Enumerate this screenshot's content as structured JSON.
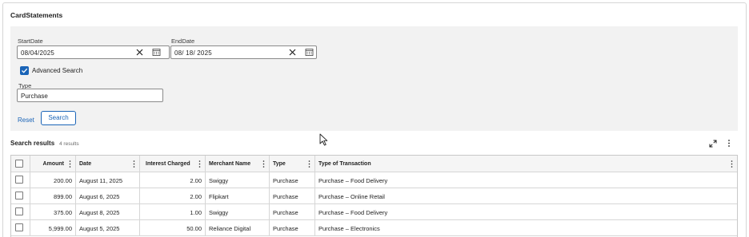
{
  "page": {
    "title": "CardStatements"
  },
  "filters": {
    "start_date_label": "StartDate",
    "start_date_value": "08/04/2025",
    "end_date_label": "EndDate",
    "end_date_value": "08/ 18/ 2025",
    "advanced_search_label": "Advanced Search",
    "advanced_search_checked": true,
    "type_label": "Type",
    "type_value": "Purchase",
    "reset_label": "Reset",
    "search_label": "Search"
  },
  "results": {
    "title": "Search results",
    "count_text": "4 results",
    "columns": [
      "Amount",
      "Date",
      "Interest Charged",
      "Merchant Name",
      "Type",
      "Type of Transaction"
    ],
    "rows": [
      {
        "amount": "200.00",
        "date": "August 11, 2025",
        "interest": "2.00",
        "merchant": "Swiggy",
        "type": "Purchase",
        "txn": "Purchase – Food Delivery"
      },
      {
        "amount": "899.00",
        "date": "August 6, 2025",
        "interest": "2.00",
        "merchant": "Flipkart",
        "type": "Purchase",
        "txn": "Purchase – Online Retail"
      },
      {
        "amount": "375.00",
        "date": "August 8, 2025",
        "interest": "1.00",
        "merchant": "Swiggy",
        "type": "Purchase",
        "txn": "Purchase – Food Delivery"
      },
      {
        "amount": "5,999.00",
        "date": "August 5, 2025",
        "interest": "50.00",
        "merchant": "Reliance Digital",
        "type": "Purchase",
        "txn": "Purchase – Electronics"
      }
    ]
  },
  "colors": {
    "accent": "#1a64b7",
    "panel_bg": "#f2f2f2",
    "border": "#d6d6d6"
  },
  "icons": {
    "clear": "close-icon",
    "calendar": "calendar-icon",
    "check": "checkmark-icon",
    "expand": "expand-icon",
    "more": "kebab-menu-icon"
  }
}
